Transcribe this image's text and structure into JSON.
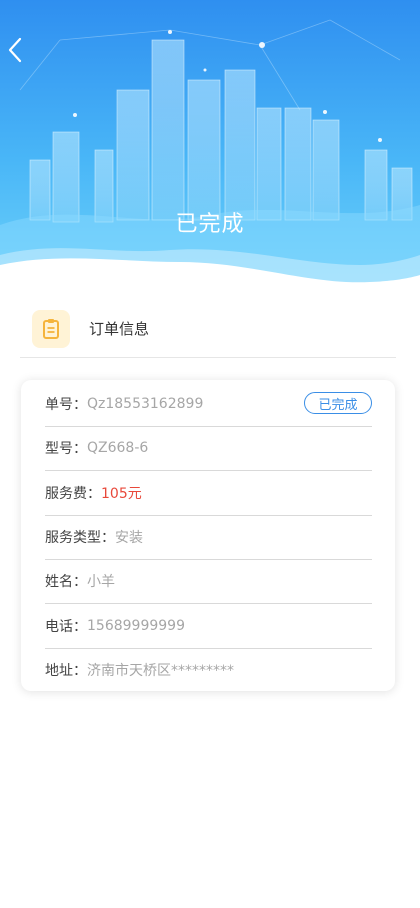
{
  "header": {
    "title": "已完成",
    "back_icon": "chevron-left-icon",
    "colors": {
      "gradient_top": "#2f8ff0",
      "gradient_bottom": "#6ed2fa"
    }
  },
  "section": {
    "title": "订单信息",
    "icon": "clipboard-icon",
    "icon_bg": "#fff3d6",
    "icon_color": "#f5b43c"
  },
  "order": {
    "status_label": "已完成",
    "fields": [
      {
        "label": "单号：",
        "value": "Qz18553162899"
      },
      {
        "label": "型号：",
        "value": "QZ668-6"
      },
      {
        "label": "服务费：",
        "value": "105元"
      },
      {
        "label": "服务类型：",
        "value": "安装"
      },
      {
        "label": "姓名：",
        "value": "小羊"
      },
      {
        "label": "电话：",
        "value": "15689999999"
      },
      {
        "label": "地址：",
        "value": "济南市天桥区*********"
      }
    ]
  },
  "colors": {
    "accent": "#3a8ee6",
    "price": "#e8483a"
  }
}
